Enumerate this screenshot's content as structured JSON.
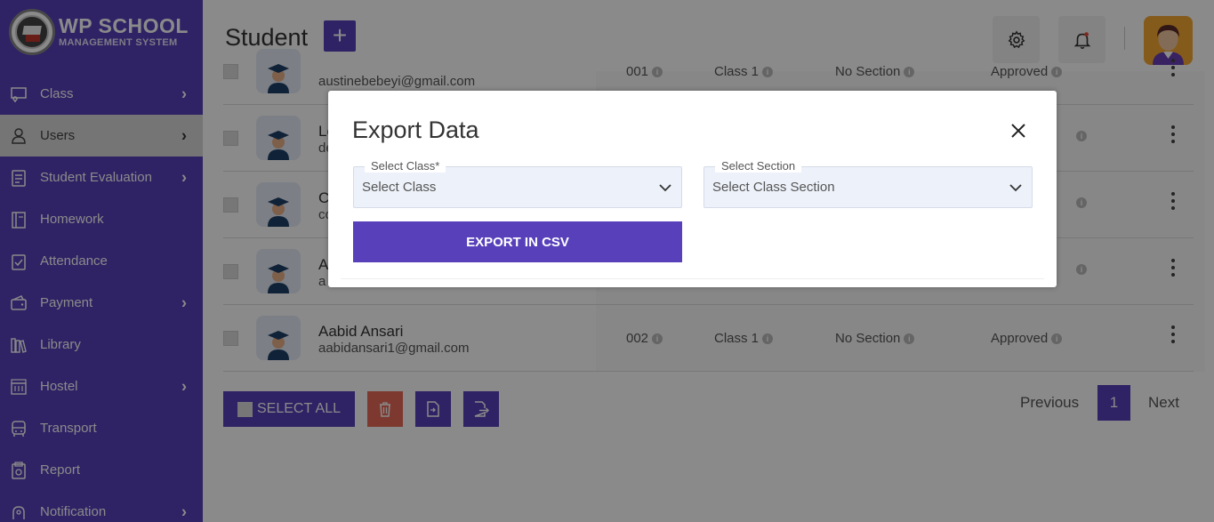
{
  "brand": {
    "title": "WP SCHOOL",
    "subtitle": "MANAGEMENT SYSTEM"
  },
  "sidebar": {
    "items": [
      {
        "label": "Class",
        "icon": "class-icon",
        "has_submenu": true
      },
      {
        "label": "Users",
        "icon": "user-icon",
        "has_submenu": true,
        "active": true
      },
      {
        "label": "Student Evaluation",
        "icon": "evaluation-icon",
        "has_submenu": true
      },
      {
        "label": "Homework",
        "icon": "homework-icon",
        "has_submenu": false
      },
      {
        "label": "Attendance",
        "icon": "attendance-icon",
        "has_submenu": false
      },
      {
        "label": "Payment",
        "icon": "wallet-icon",
        "has_submenu": true
      },
      {
        "label": "Library",
        "icon": "library-icon",
        "has_submenu": false
      },
      {
        "label": "Hostel",
        "icon": "hostel-icon",
        "has_submenu": true
      },
      {
        "label": "Transport",
        "icon": "bus-icon",
        "has_submenu": false
      },
      {
        "label": "Report",
        "icon": "report-icon",
        "has_submenu": false
      },
      {
        "label": "Notification",
        "icon": "notification-icon",
        "has_submenu": true
      }
    ]
  },
  "header": {
    "title": "Student",
    "add_label": "+"
  },
  "table": {
    "rows": [
      {
        "name": "",
        "email": "austinebebeyi@gmail.com",
        "roll": "001",
        "class": "Class 1",
        "section": "No Section",
        "status": "Approved"
      },
      {
        "name": "Le",
        "email": "de",
        "roll": "",
        "class": "",
        "section": "",
        "status": ""
      },
      {
        "name": "C",
        "email": "co",
        "roll": "",
        "class": "",
        "section": "",
        "status": ""
      },
      {
        "name": "A",
        "email": "a",
        "roll": "",
        "class": "",
        "section": "",
        "status": ""
      },
      {
        "name": "Aabid Ansari",
        "email": "aabidansari1@gmail.com",
        "roll": "002",
        "class": "Class 1",
        "section": "No Section",
        "status": "Approved"
      }
    ]
  },
  "footer": {
    "select_all": "SELECT ALL",
    "previous": "Previous",
    "page": "1",
    "next": "Next"
  },
  "modal": {
    "title": "Export Data",
    "class_label": "Select Class*",
    "class_value": "Select Class",
    "section_label": "Select Section",
    "section_value": "Select Class Section",
    "export_label": "EXPORT IN CSV"
  },
  "colors": {
    "primary": "#5840bb",
    "danger": "#e86a5a",
    "overlay": "rgba(0,0,0,0.46)"
  }
}
